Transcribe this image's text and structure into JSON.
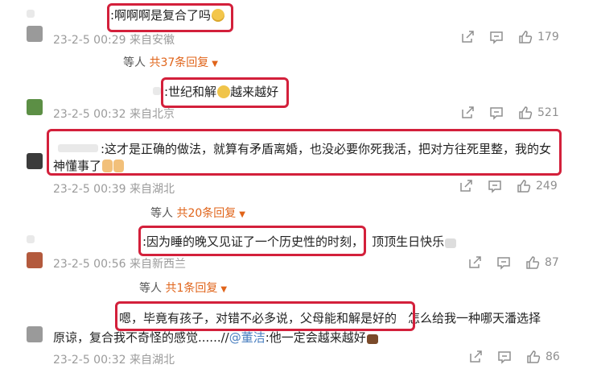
{
  "comments": [
    {
      "text": ":啊啊啊是复合了吗",
      "meta": "23-2-5 00:29 来自安徽",
      "likes": "179",
      "replies": {
        "prefix": "等人",
        "count": "共37条回复"
      }
    },
    {
      "text": ":世纪和解",
      "text_after": "越来越好",
      "meta": "23-2-5 00:32 来自北京",
      "likes": "521"
    },
    {
      "text_line1": ":这才是正确的做法，就算有矛盾离婚，也没必要你死我活，把对方往死里整，我的女",
      "text_line2": "神懂事了",
      "meta": "23-2-5 00:39 来自湖北",
      "likes": "249",
      "replies": {
        "prefix": "等人",
        "count": "共20条回复"
      }
    },
    {
      "text": ":因为睡的晚又见证了一个历史性的时刻，",
      "text_after": "顶顶生日快乐",
      "meta": "23-2-5 00:56 来自新西兰",
      "likes": "87",
      "replies": {
        "prefix": "等人",
        "count": "共1条回复"
      }
    },
    {
      "text_boxed": "嗯，毕竟有孩子，对错不必多说，父母能和解是好的",
      "text_after": "怎么给我一种哪天潘选择",
      "text_line2": "原谅，复合我不奇怪的感觉......//",
      "mention": "@董洁",
      "text_line2_after": ":他一定会越来越好",
      "meta": "23-2-5 00:32 来自湖北",
      "likes": "86"
    }
  ]
}
